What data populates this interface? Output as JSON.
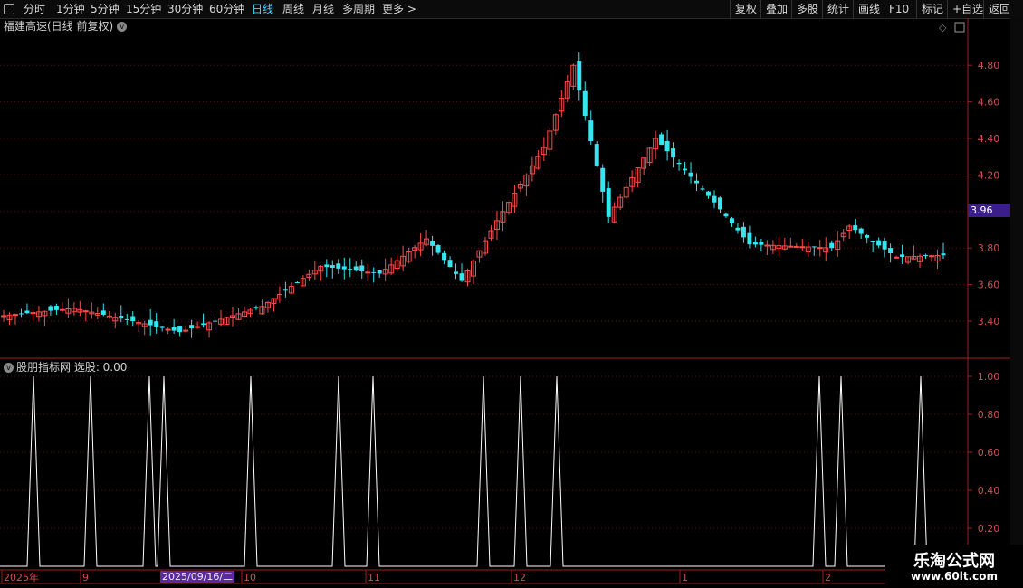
{
  "toolbar": {
    "periods": [
      "分时",
      "1分钟",
      "5分钟",
      "15分钟",
      "30分钟",
      "60分钟",
      "日线",
      "周线",
      "月线",
      "多周期",
      "更多 >"
    ],
    "active_period": "日线",
    "right_buttons": [
      "复权",
      "叠加",
      "多股",
      "统计",
      "画线",
      "F10",
      "标记",
      "+自选",
      "返回"
    ]
  },
  "main_chart": {
    "title": "福建高速(日线 前复权)",
    "price_ticks": [
      "4.80",
      "4.60",
      "4.40",
      "4.20",
      "3.80",
      "3.60",
      "3.40"
    ],
    "current_price": "3.96",
    "up_color": "#ff4b4b",
    "down_color": "#35e6f0"
  },
  "indicator": {
    "title": "股朋指标网  选股: 0.00",
    "ticks": [
      "1.00",
      "0.80",
      "0.60",
      "0.40",
      "0.20"
    ]
  },
  "date_axis": {
    "labels": [
      "2025年",
      "9",
      "10",
      "11",
      "12",
      "1",
      "2"
    ],
    "cursor_date": "2025/09/16/二"
  },
  "watermark": {
    "line1": "乐淘公式网",
    "line2": "www.60lt.com"
  }
}
